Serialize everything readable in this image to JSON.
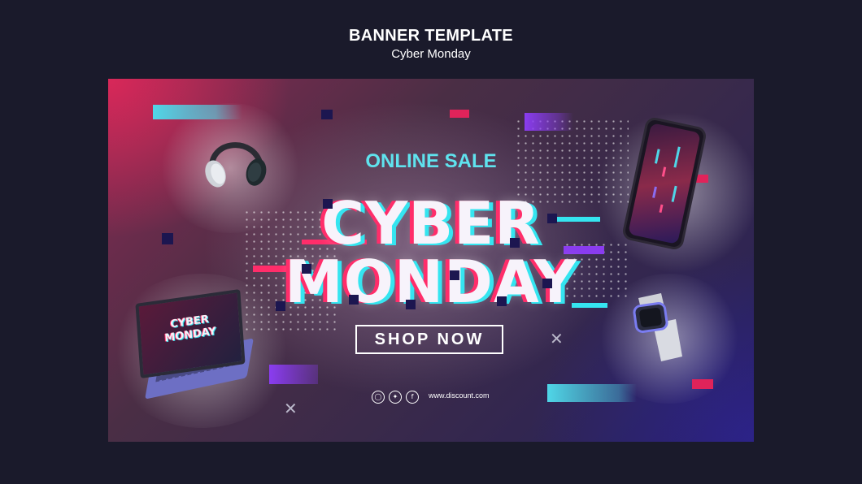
{
  "header": {
    "title": "BANNER TEMPLATE",
    "subtitle": "Cyber Monday"
  },
  "banner": {
    "tagline": "ONLINE SALE",
    "headline_line1": "CYBER",
    "headline_line2": "MONDAY",
    "cta_label": "SHOP NOW",
    "website": "www.discount.com",
    "laptop_screen_line1": "CYBER",
    "laptop_screen_line2": "MONDAY",
    "social_icons": [
      "instagram-icon",
      "twitter-icon",
      "facebook-icon"
    ]
  },
  "colors": {
    "page_background": "#1a1a2b",
    "accent_cyan": "#5fe3ee",
    "accent_pink": "#ff2d6a",
    "accent_purple": "#8a3cf0"
  }
}
